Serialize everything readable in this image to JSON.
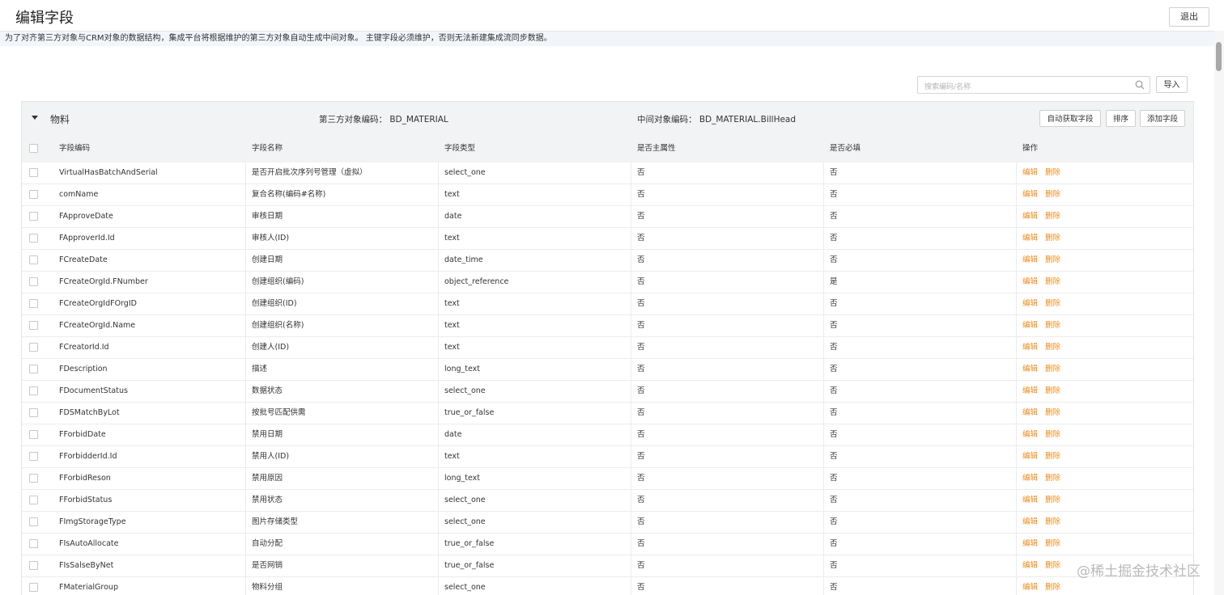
{
  "header": {
    "title": "编辑字段",
    "exit_label": "退出"
  },
  "notice": "为了对齐第三方对象与CRM对象的数据结构，集成平台将根据维护的第三方对象自动生成中间对象。 主键字段必须维护，否则无法新建集成流同步数据。",
  "toolbar": {
    "search_placeholder": "搜索编码/名称",
    "import_label": "导入"
  },
  "panel": {
    "object_name": "物料",
    "third_party_code": "第三方对象编码：  BD_MATERIAL",
    "middle_code": "中间对象编码：  BD_MATERIAL.BillHead",
    "buttons": {
      "auto_fetch": "自动获取字段",
      "sort": "排序",
      "add_field": "添加字段"
    }
  },
  "table": {
    "columns": {
      "code": "字段编码",
      "name": "字段名称",
      "type": "字段类型",
      "is_primary": "是否主属性",
      "required": "是否必填",
      "ops": "操作"
    },
    "edit_label": "编辑",
    "delete_label": "删除",
    "rows": [
      {
        "code": "VirtualHasBatchAndSerial",
        "name": "是否开启批次序列号管理（虚拟）",
        "type": "select_one",
        "primary": "否",
        "required": "否"
      },
      {
        "code": "comName",
        "name": "复合名称(编码#名称)",
        "type": "text",
        "primary": "否",
        "required": "否"
      },
      {
        "code": "FApproveDate",
        "name": "审核日期",
        "type": "date",
        "primary": "否",
        "required": "否"
      },
      {
        "code": "FApproverId.Id",
        "name": "审核人(ID)",
        "type": "text",
        "primary": "否",
        "required": "否"
      },
      {
        "code": "FCreateDate",
        "name": "创建日期",
        "type": "date_time",
        "primary": "否",
        "required": "否"
      },
      {
        "code": "FCreateOrgId.FNumber",
        "name": "创建组织(编码)",
        "type": "object_reference",
        "primary": "否",
        "required": "是"
      },
      {
        "code": "FCreateOrgIdFOrgID",
        "name": "创建组织(ID)",
        "type": "text",
        "primary": "否",
        "required": "否"
      },
      {
        "code": "FCreateOrgId.Name",
        "name": "创建组织(名称)",
        "type": "text",
        "primary": "否",
        "required": "否"
      },
      {
        "code": "FCreatorId.Id",
        "name": "创建人(ID)",
        "type": "text",
        "primary": "否",
        "required": "否"
      },
      {
        "code": "FDescription",
        "name": "描述",
        "type": "long_text",
        "primary": "否",
        "required": "否"
      },
      {
        "code": "FDocumentStatus",
        "name": "数据状态",
        "type": "select_one",
        "primary": "否",
        "required": "否"
      },
      {
        "code": "FDSMatchByLot",
        "name": "按批号匹配供需",
        "type": "true_or_false",
        "primary": "否",
        "required": "否"
      },
      {
        "code": "FForbidDate",
        "name": "禁用日期",
        "type": "date",
        "primary": "否",
        "required": "否"
      },
      {
        "code": "FForbidderId.Id",
        "name": "禁用人(ID)",
        "type": "text",
        "primary": "否",
        "required": "否"
      },
      {
        "code": "FForbidReson",
        "name": "禁用原因",
        "type": "long_text",
        "primary": "否",
        "required": "否"
      },
      {
        "code": "FForbidStatus",
        "name": "禁用状态",
        "type": "select_one",
        "primary": "否",
        "required": "否"
      },
      {
        "code": "FImgStorageType",
        "name": "图片存储类型",
        "type": "select_one",
        "primary": "否",
        "required": "否"
      },
      {
        "code": "FIsAutoAllocate",
        "name": "自动分配",
        "type": "true_or_false",
        "primary": "否",
        "required": "否"
      },
      {
        "code": "FIsSalseByNet",
        "name": "是否网销",
        "type": "true_or_false",
        "primary": "否",
        "required": "否"
      },
      {
        "code": "FMaterialGroup",
        "name": "物料分组",
        "type": "select_one",
        "primary": "否",
        "required": "否"
      }
    ]
  },
  "watermark": "@稀土掘金技术社区",
  "colors": {
    "accent_orange": "#f08c1e",
    "header_bg": "#f2f3f5",
    "notice_bg": "#f2f6fb"
  }
}
